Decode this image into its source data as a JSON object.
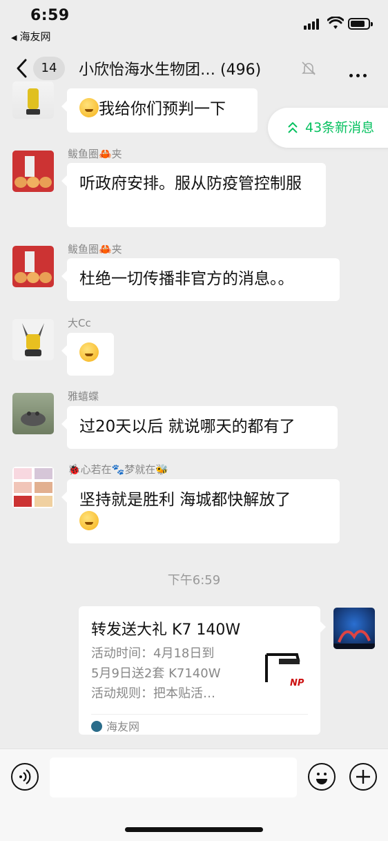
{
  "status_bar": {
    "time": "6:59",
    "back_app_label": "海友网"
  },
  "nav": {
    "unread_count": "14",
    "title": "小欣怡海水生物团… (496)"
  },
  "new_messages": {
    "label": "43条新消息"
  },
  "messages": [
    {
      "text": "我给你们预判一下",
      "has_emoji": true
    },
    {
      "sender": "鲅鱼圈🦀夹",
      "text": "听政府安排。服从防疫管控制服"
    },
    {
      "sender": "鲅鱼圈🦀夹",
      "text": "杜绝一切传播非官方的消息。。"
    },
    {
      "sender": "大Cc",
      "text": "",
      "has_emoji": true
    },
    {
      "sender": "雅蟢蝶",
      "text": "过20天以后 就说哪天的都有了"
    },
    {
      "sender": "🐞心若在🐾梦就在🐝",
      "text": "坚持就是胜利   海城都快解放了",
      "has_emoji": true
    }
  ],
  "timestamp": "下午6:59",
  "share_card": {
    "title": "转发送大礼 K7 140W",
    "desc_line1": "活动时间：4月18日到",
    "desc_line2": "5月9日送2套 K7140W",
    "desc_line3": "活动规则：把本贴活…",
    "thumb_text": "NP",
    "source": "海友网"
  },
  "colors": {
    "background": "#ededed",
    "accent_green": "#07c160",
    "bubble": "#ffffff"
  }
}
